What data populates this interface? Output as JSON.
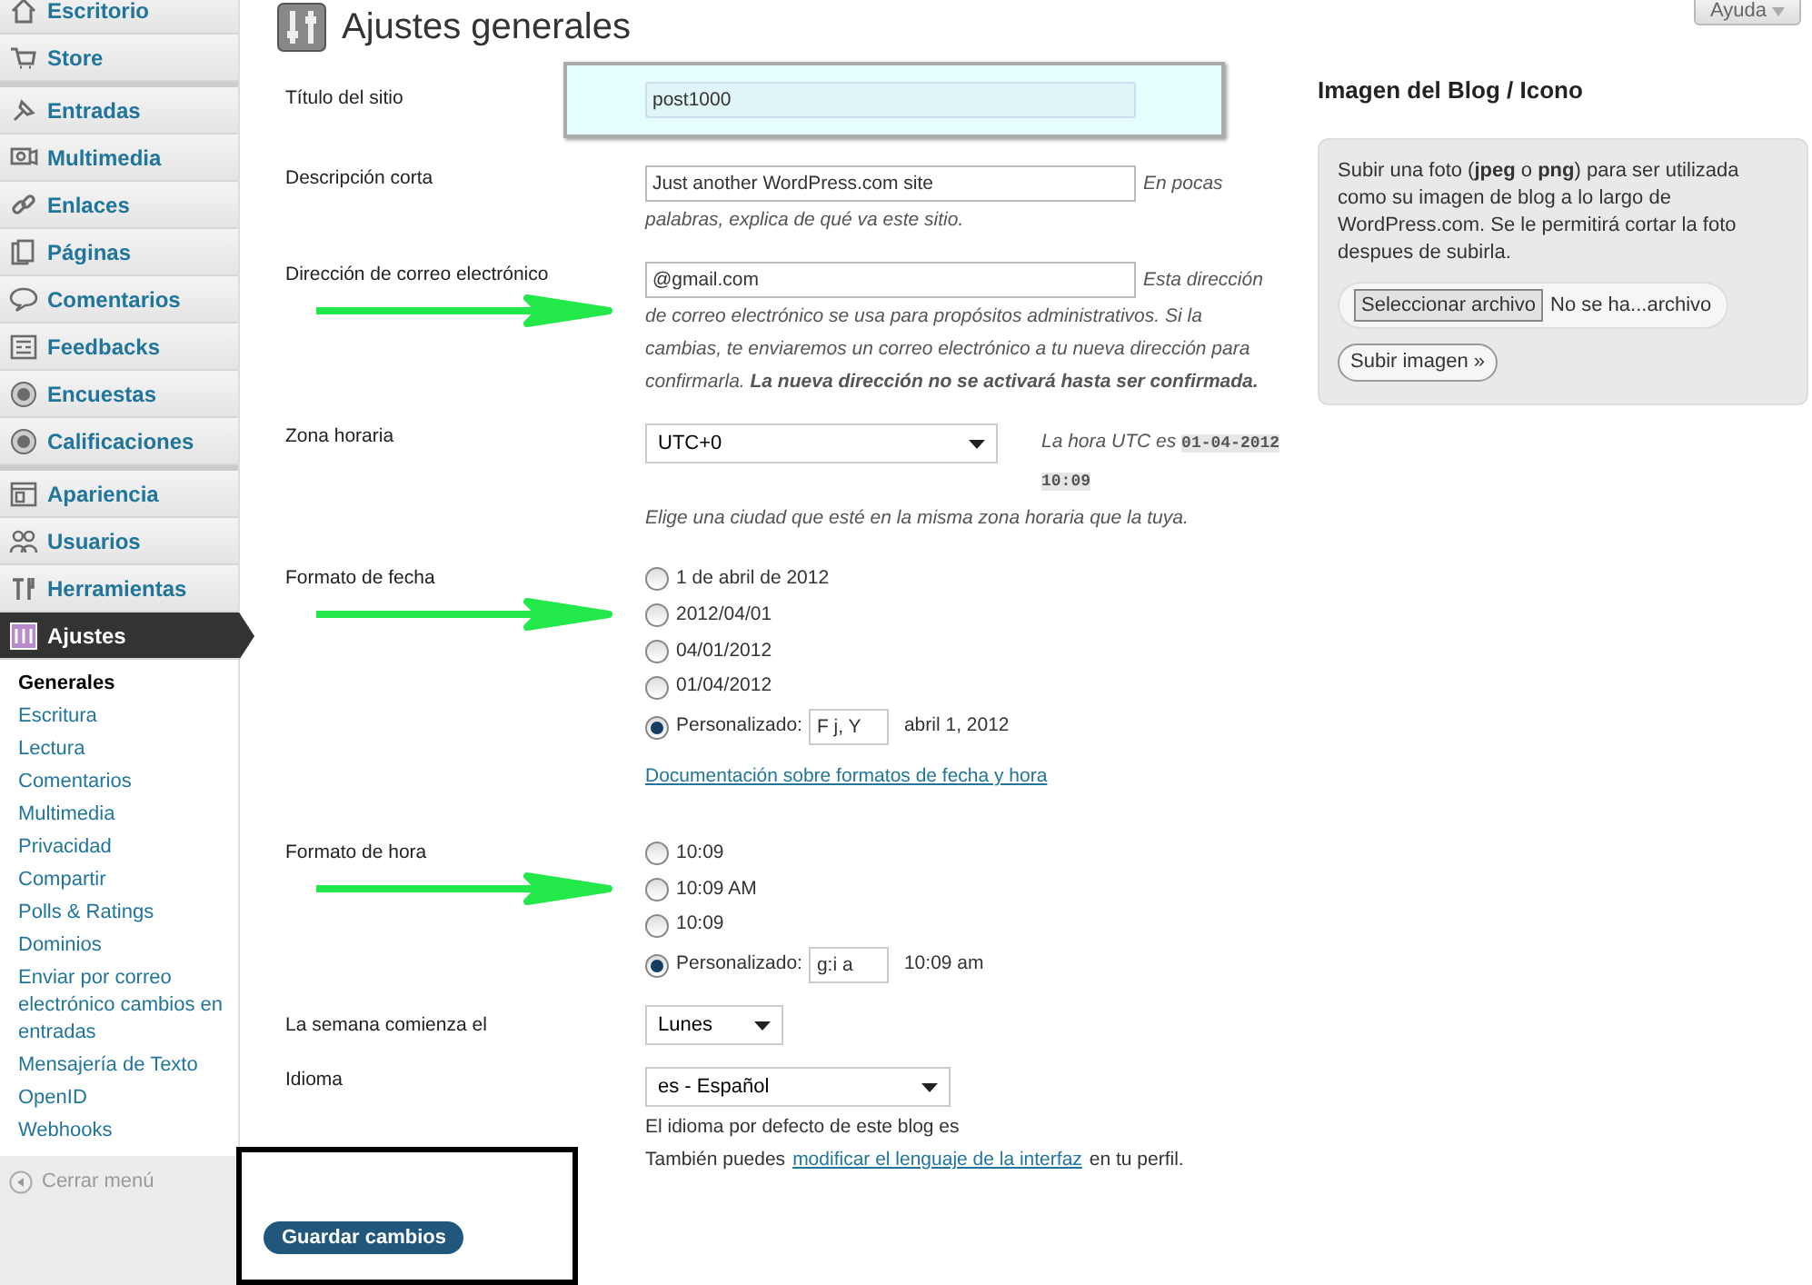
{
  "sidebar": {
    "groups": [
      [
        {
          "label": "Escritorio",
          "selected": false
        },
        {
          "label": "Store",
          "selected": false
        }
      ],
      [
        {
          "label": "Entradas",
          "selected": false
        },
        {
          "label": "Multimedia",
          "selected": false
        },
        {
          "label": "Enlaces",
          "selected": false
        },
        {
          "label": "Páginas",
          "selected": false
        },
        {
          "label": "Comentarios",
          "selected": false
        },
        {
          "label": "Feedbacks",
          "selected": false
        },
        {
          "label": "Encuestas",
          "selected": false
        },
        {
          "label": "Calificaciones",
          "selected": false
        }
      ],
      [
        {
          "label": "Apariencia",
          "selected": false
        },
        {
          "label": "Usuarios",
          "selected": false
        },
        {
          "label": "Herramientas",
          "selected": false
        },
        {
          "label": "Ajustes",
          "selected": true
        }
      ]
    ],
    "submenu": [
      {
        "label": "Generales",
        "selected": true
      },
      {
        "label": "Escritura",
        "selected": false
      },
      {
        "label": "Lectura",
        "selected": false
      },
      {
        "label": "Comentarios",
        "selected": false
      },
      {
        "label": "Multimedia",
        "selected": false
      },
      {
        "label": "Privacidad",
        "selected": false
      },
      {
        "label": "Compartir",
        "selected": false
      },
      {
        "label": "Polls & Ratings",
        "selected": false
      },
      {
        "label": "Dominios",
        "selected": false
      },
      {
        "label": "Enviar por correo electrónico cambios en entradas",
        "selected": false
      },
      {
        "label": "Mensajería de Texto",
        "selected": false
      },
      {
        "label": "OpenID",
        "selected": false
      },
      {
        "label": "Webhooks",
        "selected": false
      }
    ],
    "collapse": "Cerrar menú"
  },
  "header": {
    "title": "Ajustes generales",
    "help_button": "Ayuda"
  },
  "fields": [
    {
      "kind": "text",
      "label": "Título del sitio",
      "value": "post1000",
      "highlighted": true
    },
    {
      "kind": "text",
      "label": "Descripción corta",
      "value": "Just another WordPress.com site",
      "help": [
        "En pocas",
        "palabras, explica de qué va este sitio."
      ]
    },
    {
      "kind": "text",
      "label": "Dirección de correo electrónico",
      "value": "@gmail.com",
      "help": [
        "Esta dirección",
        "de correo electrónico se usa para propósitos administrativos. Si la cambias, te enviaremos un correo electrónico a tu nueva dirección para confirmarla. **La nueva dirección no se activará hasta ser confirmada.**"
      ],
      "arrow": true
    },
    {
      "kind": "timezone",
      "label": "Zona horaria",
      "value": "UTC+0",
      "utc_label": "La hora UTC es",
      "utc_time": "01-04-2012 10:09",
      "help": "Elige una ciudad que esté en la misma zona horaria que la tuya."
    },
    {
      "kind": "radios",
      "label": "Formato de fecha",
      "arrow": true,
      "options": [
        {
          "kind": "preset",
          "label": "1 de abril de 2012",
          "selected": false
        },
        {
          "kind": "preset",
          "label": "2012/04/01",
          "selected": false
        },
        {
          "kind": "preset",
          "label": "04/01/2012",
          "selected": false
        },
        {
          "kind": "preset",
          "label": "01/04/2012",
          "selected": false
        },
        {
          "kind": "custom",
          "label": "Personalizado:",
          "value": "F j, Y",
          "preview": "abril 1, 2012",
          "selected": true
        }
      ],
      "link": "Documentación sobre formatos de fecha y hora"
    },
    {
      "kind": "radios",
      "label": "Formato de hora",
      "arrow": true,
      "options": [
        {
          "kind": "preset",
          "label": "10:09",
          "selected": false
        },
        {
          "kind": "preset",
          "label": "10:09 AM",
          "selected": false
        },
        {
          "kind": "preset",
          "label": "10:09",
          "selected": false
        },
        {
          "kind": "custom",
          "label": "Personalizado:",
          "value": "g:i a",
          "preview": "10:09 am",
          "selected": true
        }
      ]
    },
    {
      "kind": "select",
      "label": "La semana comienza el",
      "value": "Lunes"
    },
    {
      "kind": "language",
      "label": "Idioma",
      "value": "es - Español",
      "note": "El idioma por defecto de este blog es",
      "note2_before": "También puedes",
      "note2_link": "modificar el lenguaje de la interfaz",
      "note2_after": "en tu perfil."
    }
  ],
  "save_button": {
    "label": "Guardar cambios",
    "framed": true
  },
  "blog_image": {
    "title": "Imagen del Blog / Icono",
    "description": "Subir una foto (**jpeg** o **png**) para ser utilizada como su imagen de blog a lo largo de WordPress.com. Se le permitirá cortar la foto despues de subirla.",
    "file_button": "Seleccionar archivo",
    "file_status": "No se ha...archivo",
    "upload_button": "Subir imagen »"
  }
}
